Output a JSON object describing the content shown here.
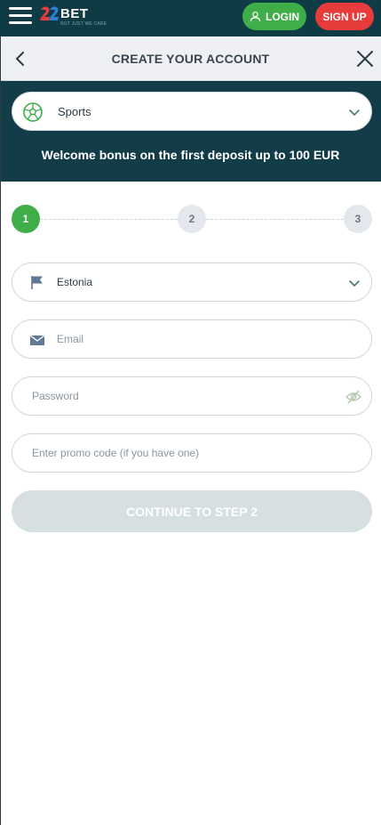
{
  "brand": {
    "logo_text": "BET",
    "tagline": "NOT JUST WE CARE"
  },
  "header": {
    "login_label": "LOGIN",
    "signup_label": "SIGN UP"
  },
  "panel": {
    "title": "CREATE YOUR ACCOUNT"
  },
  "bonus_select": {
    "selected": "Sports",
    "message": "Welcome bonus on the first deposit up to 100 EUR"
  },
  "steps": [
    {
      "label": "1",
      "state": "active"
    },
    {
      "label": "2",
      "state": "idle"
    },
    {
      "label": "3",
      "state": "idle"
    }
  ],
  "form": {
    "country": "Estonia",
    "email_placeholder": "Email",
    "password_placeholder": "Password",
    "promo_placeholder": "Enter promo code (if you have one)",
    "continue_label": "CONTINUE TO STEP 2"
  },
  "colors": {
    "brand_dark": "#0f3b45",
    "accent_green": "#3fae49",
    "accent_red": "#e83c3c",
    "disabled_button": "#d6dfe2"
  },
  "icons": [
    "menu-icon",
    "user-icon",
    "back-arrow-icon",
    "close-icon",
    "soccer-ball-icon",
    "chevron-down-icon",
    "flag-icon",
    "envelope-icon",
    "eye-icon"
  ]
}
